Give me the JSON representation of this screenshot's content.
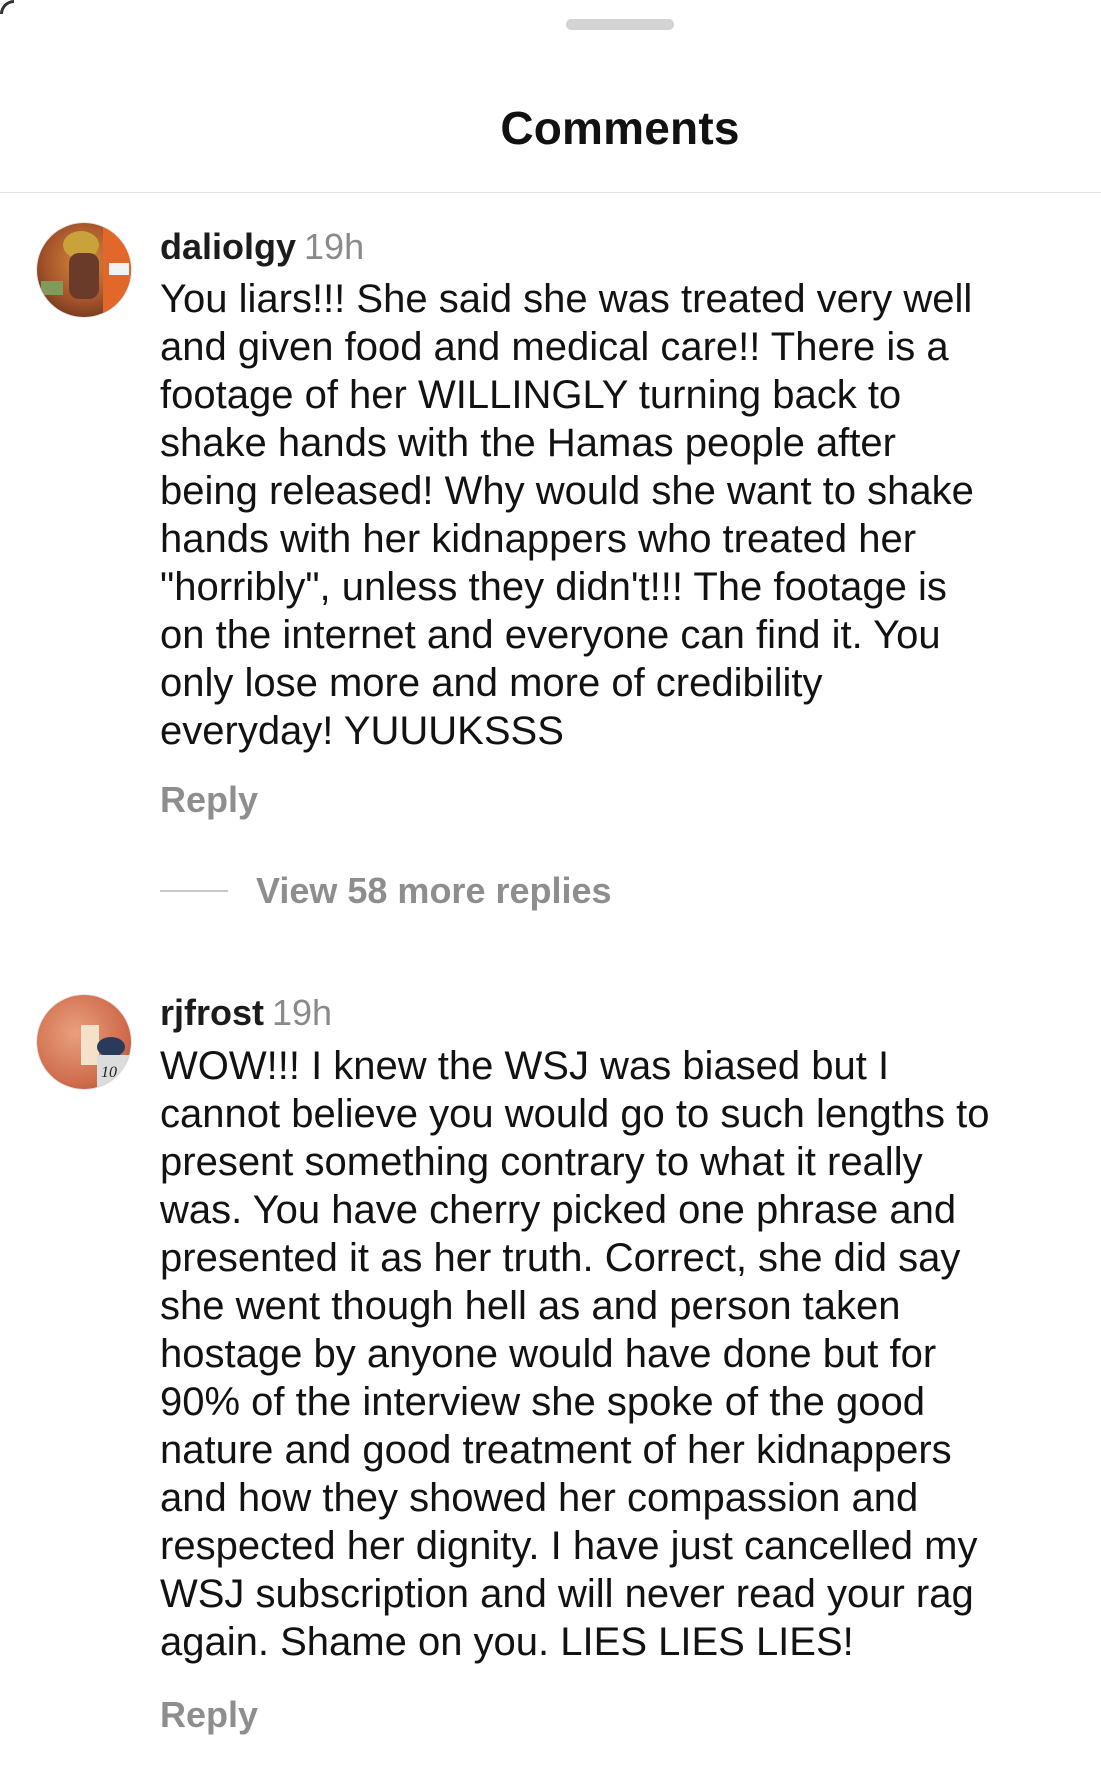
{
  "header": {
    "title": "Comments"
  },
  "comments": [
    {
      "username": "daliolgy",
      "time": "19h",
      "avatar_icon": "user-avatar-photo",
      "lines": [
        "You liars!!! She said she was treated very well",
        "and given food and medical care!! There is a",
        "footage of her WILLINGLY turning back to",
        "shake hands with the Hamas people after",
        "being released! Why would she want to shake",
        "hands with her kidnappers who treated her",
        "\"horribly\", unless they didn't!!! The footage is",
        "on the internet and everyone can find it. You",
        "only lose more and more of credibility",
        "everyday! YUUUKSSS"
      ],
      "reply_label": "Reply",
      "view_replies_label": "View 58 more replies"
    },
    {
      "username": "rjfrost",
      "time": "19h",
      "avatar_icon": "user-avatar-photo",
      "lines": [
        "WOW!!! I knew the WSJ was biased but I",
        "cannot believe you would go to such lengths to",
        "present something contrary to what it really",
        "was. You have cherry picked one phrase and",
        "presented it as her truth. Correct, she did say",
        "she went though hell as and person taken",
        "hostage by anyone would have done but for",
        "90% of the interview she spoke of the good",
        "nature and good treatment of her kidnappers",
        "and how they showed her compassion and",
        "respected her dignity. I have just cancelled my",
        "WSJ subscription and will never read your rag",
        "again. Shame on you. LIES LIES LIES!"
      ],
      "reply_label": "Reply"
    }
  ],
  "colors": {
    "muted": "#8e8e8e",
    "text": "#121212",
    "divider": "#e2e2e2"
  }
}
